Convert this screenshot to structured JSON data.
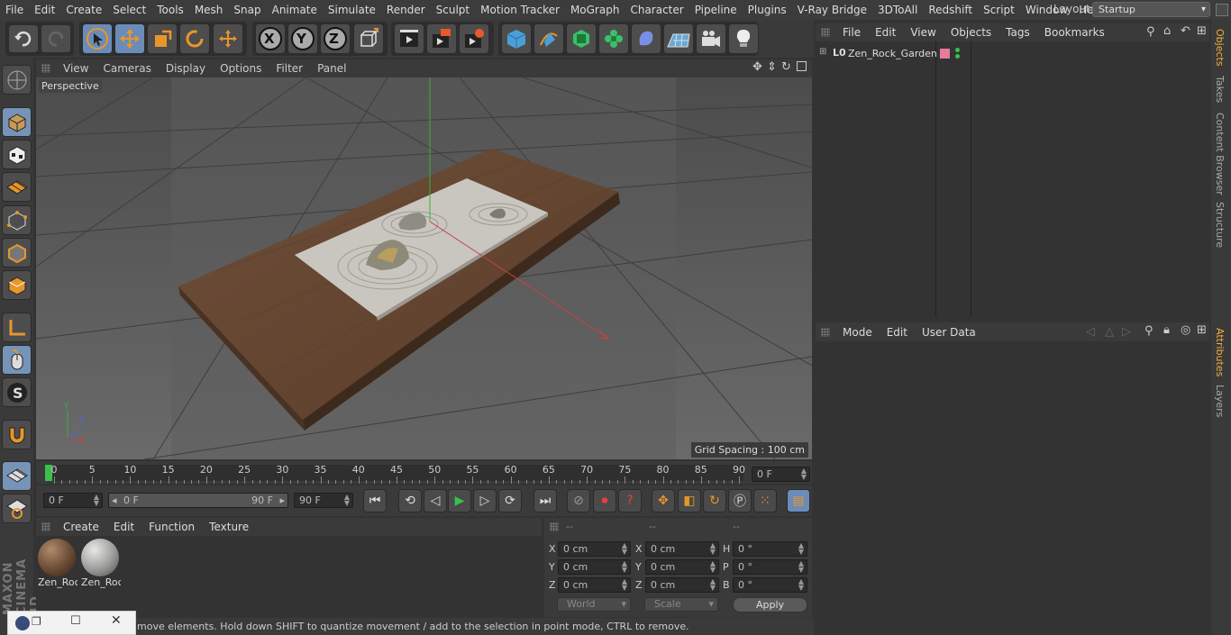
{
  "menu": [
    "File",
    "Edit",
    "Create",
    "Select",
    "Tools",
    "Mesh",
    "Snap",
    "Animate",
    "Simulate",
    "Render",
    "Sculpt",
    "Motion Tracker",
    "MoGraph",
    "Character",
    "Pipeline",
    "Plugins",
    "V-Ray Bridge",
    "3DToAll",
    "Redshift",
    "Script",
    "Window",
    "Help"
  ],
  "layout": {
    "label": "Layout:",
    "value": "Startup"
  },
  "axis_buttons": [
    "X",
    "Y",
    "Z"
  ],
  "viewport": {
    "menu": [
      "View",
      "Cameras",
      "Display",
      "Options",
      "Filter",
      "Panel"
    ],
    "label": "Perspective",
    "grid_spacing": "Grid Spacing : 100 cm"
  },
  "timeline": {
    "ticks": [
      "0",
      "5",
      "10",
      "15",
      "20",
      "25",
      "30",
      "35",
      "40",
      "45",
      "50",
      "55",
      "60",
      "65",
      "70",
      "75",
      "80",
      "85",
      "90"
    ],
    "current_frame": "0 F"
  },
  "transport": {
    "start_field": "0 F",
    "range_start": "0 F",
    "range_end": "90 F",
    "end_field": "90 F"
  },
  "materials": {
    "menu": [
      "Create",
      "Edit",
      "Function",
      "Texture"
    ],
    "items": [
      {
        "label": "Zen_Roc"
      },
      {
        "label": "Zen_Roc"
      }
    ]
  },
  "coords": {
    "headers": [
      "--",
      "--",
      "--"
    ],
    "rows": [
      {
        "a": "X",
        "av": "0 cm",
        "b": "X",
        "bv": "0 cm",
        "c": "H",
        "cv": "0 °"
      },
      {
        "a": "Y",
        "av": "0 cm",
        "b": "Y",
        "bv": "0 cm",
        "c": "P",
        "cv": "0 °"
      },
      {
        "a": "Z",
        "av": "0 cm",
        "b": "Z",
        "bv": "0 cm",
        "c": "B",
        "cv": "0 °"
      }
    ],
    "space": "World",
    "mode": "Scale",
    "apply": "Apply"
  },
  "status": "move elements. Hold down SHIFT to quantize movement / add to the selection in point mode, CTRL to remove.",
  "objects": {
    "menu": [
      "File",
      "Edit",
      "View",
      "Objects",
      "Tags",
      "Bookmarks"
    ],
    "items": [
      {
        "name": "Zen_Rock_Garden",
        "icon": "L0"
      }
    ]
  },
  "attributes": {
    "menu": [
      "Mode",
      "Edit",
      "User Data"
    ]
  },
  "side_tabs": [
    "Objects",
    "Takes",
    "Content Browser",
    "Structure",
    "Attributes",
    "Layers"
  ],
  "brand": {
    "line1": "MAXON",
    "line2": "CINEMA 4D"
  }
}
